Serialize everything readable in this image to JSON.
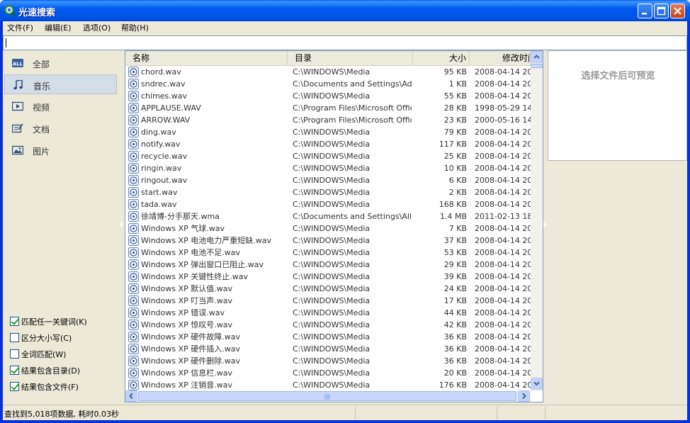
{
  "app": {
    "title": "光速搜索",
    "accent": "#0054E3"
  },
  "menu": [
    {
      "label": "文件(F)"
    },
    {
      "label": "编辑(E)"
    },
    {
      "label": "选项(O)"
    },
    {
      "label": "帮助(H)"
    }
  ],
  "search": {
    "value": ""
  },
  "categories": [
    {
      "label": "全部",
      "icon": "all-icon",
      "selected": false
    },
    {
      "label": "音乐",
      "icon": "music-icon",
      "selected": true
    },
    {
      "label": "视频",
      "icon": "video-icon",
      "selected": false
    },
    {
      "label": "文档",
      "icon": "document-icon",
      "selected": false
    },
    {
      "label": "图片",
      "icon": "picture-icon",
      "selected": false
    }
  ],
  "options": [
    {
      "label": "匹配任一关键词(K)",
      "checked": true
    },
    {
      "label": "区分大小写(C)",
      "checked": false
    },
    {
      "label": "全词匹配(W)",
      "checked": false
    },
    {
      "label": "结果包含目录(D)",
      "checked": true
    },
    {
      "label": "结果包含文件(F)",
      "checked": true
    }
  ],
  "columns": {
    "name": "名称",
    "dir": "目录",
    "size": "大小",
    "modified": "修改时间"
  },
  "files": [
    {
      "name": "chord.wav",
      "dir": "C:\\WINDOWS\\Media",
      "size": "95 KB",
      "modified": "2008-04-14 20:..."
    },
    {
      "name": "sndrec.wav",
      "dir": "C:\\Documents and Settings\\Ad...",
      "size": "1 KB",
      "modified": "2008-04-14 20:..."
    },
    {
      "name": "chimes.wav",
      "dir": "C:\\WINDOWS\\Media",
      "size": "55 KB",
      "modified": "2008-04-14 20:..."
    },
    {
      "name": "APPLAUSE.WAV",
      "dir": "C:\\Program Files\\Microsoft Offic...",
      "size": "28 KB",
      "modified": "1998-05-29 14:..."
    },
    {
      "name": "ARROW.WAV",
      "dir": "C:\\Program Files\\Microsoft Offic...",
      "size": "23 KB",
      "modified": "2000-05-16 14:..."
    },
    {
      "name": "ding.wav",
      "dir": "C:\\WINDOWS\\Media",
      "size": "79 KB",
      "modified": "2008-04-14 20:..."
    },
    {
      "name": "notify.wav",
      "dir": "C:\\WINDOWS\\Media",
      "size": "117 KB",
      "modified": "2008-04-14 20:..."
    },
    {
      "name": "recycle.wav",
      "dir": "C:\\WINDOWS\\Media",
      "size": "25 KB",
      "modified": "2008-04-14 20:..."
    },
    {
      "name": "ringin.wav",
      "dir": "C:\\WINDOWS\\Media",
      "size": "10 KB",
      "modified": "2008-04-14 20:..."
    },
    {
      "name": "ringout.wav",
      "dir": "C:\\WINDOWS\\Media",
      "size": "6 KB",
      "modified": "2008-04-14 20:..."
    },
    {
      "name": "start.wav",
      "dir": "C:\\WINDOWS\\Media",
      "size": "2 KB",
      "modified": "2008-04-14 20:..."
    },
    {
      "name": "tada.wav",
      "dir": "C:\\WINDOWS\\Media",
      "size": "168 KB",
      "modified": "2008-04-14 20:..."
    },
    {
      "name": "徐靖博-分手那天.wma",
      "dir": "C:\\Documents and Settings\\All ...",
      "size": "1.4 MB",
      "modified": "2011-02-13 18:..."
    },
    {
      "name": "Windows XP 气球.wav",
      "dir": "C:\\WINDOWS\\Media",
      "size": "7 KB",
      "modified": "2008-04-14 20:..."
    },
    {
      "name": "Windows XP 电池电力严重短缺.wav",
      "dir": "C:\\WINDOWS\\Media",
      "size": "37 KB",
      "modified": "2008-04-14 20:..."
    },
    {
      "name": "Windows XP 电池不足.wav",
      "dir": "C:\\WINDOWS\\Media",
      "size": "53 KB",
      "modified": "2008-04-14 20:..."
    },
    {
      "name": "Windows XP 弹出窗口已阻止.wav",
      "dir": "C:\\WINDOWS\\Media",
      "size": "29 KB",
      "modified": "2008-04-14 20:..."
    },
    {
      "name": "Windows XP 关键性终止.wav",
      "dir": "C:\\WINDOWS\\Media",
      "size": "39 KB",
      "modified": "2008-04-14 20:..."
    },
    {
      "name": "Windows XP 默认值.wav",
      "dir": "C:\\WINDOWS\\Media",
      "size": "24 KB",
      "modified": "2008-04-14 20:..."
    },
    {
      "name": "Windows XP 叮当声.wav",
      "dir": "C:\\WINDOWS\\Media",
      "size": "17 KB",
      "modified": "2008-04-14 20:..."
    },
    {
      "name": "Windows XP 错误.wav",
      "dir": "C:\\WINDOWS\\Media",
      "size": "44 KB",
      "modified": "2008-04-14 20:..."
    },
    {
      "name": "Windows XP 惊叹号.wav",
      "dir": "C:\\WINDOWS\\Media",
      "size": "42 KB",
      "modified": "2008-04-14 20:..."
    },
    {
      "name": "Windows XP 硬件故障.wav",
      "dir": "C:\\WINDOWS\\Media",
      "size": "36 KB",
      "modified": "2008-04-14 20:..."
    },
    {
      "name": "Windows XP 硬件插入.wav",
      "dir": "C:\\WINDOWS\\Media",
      "size": "36 KB",
      "modified": "2008-04-14 20:..."
    },
    {
      "name": "Windows XP 硬件删除.wav",
      "dir": "C:\\WINDOWS\\Media",
      "size": "36 KB",
      "modified": "2008-04-14 20:..."
    },
    {
      "name": "Windows XP 信息栏.wav",
      "dir": "C:\\WINDOWS\\Media",
      "size": "20 KB",
      "modified": "2008-04-14 20:..."
    },
    {
      "name": "Windows XP 注销音.wav",
      "dir": "C:\\WINDOWS\\Media",
      "size": "176 KB",
      "modified": "2008-04-14 20:..."
    }
  ],
  "preview": {
    "placeholder": "选择文件后可预览"
  },
  "status": {
    "text": "查找到5,018项数据, 耗时0.03秒"
  }
}
